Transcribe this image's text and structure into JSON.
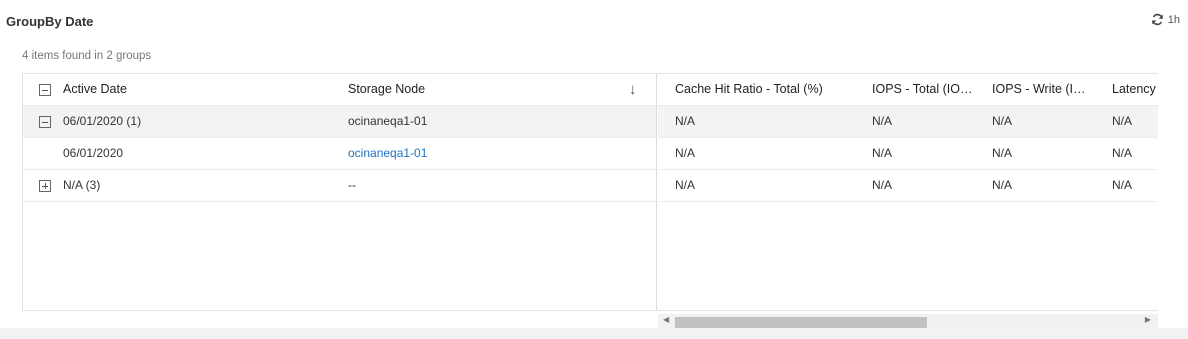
{
  "widget": {
    "title": "GroupBy Date",
    "refresh_label": "1h",
    "count_text": "4 items found in 2 groups"
  },
  "columns": {
    "active_date": "Active Date",
    "storage_node": "Storage Node",
    "cache_hit": "Cache Hit Ratio - Total (%)",
    "iops_total": "IOPS - Total (IO…",
    "iops_write": "IOPS - Write (I…",
    "latency": "Latency"
  },
  "rows": [
    {
      "active_date": "06/01/2020 (1)",
      "storage_node": "ocinaneqa1-01",
      "cache_hit": "N/A",
      "iops_total": "N/A",
      "iops_write": "N/A",
      "latency": "N/A"
    },
    {
      "active_date": "06/01/2020",
      "storage_node": "ocinaneqa1-01",
      "cache_hit": "N/A",
      "iops_total": "N/A",
      "iops_write": "N/A",
      "latency": "N/A"
    },
    {
      "active_date": "N/A (3)",
      "storage_node": "--",
      "cache_hit": "N/A",
      "iops_total": "N/A",
      "iops_write": "N/A",
      "latency": "N/A"
    }
  ],
  "icons": {
    "refresh": "refresh-icon",
    "collapse": "minus-box-icon",
    "expand": "plus-box-icon",
    "sort": "arrow-down-icon"
  },
  "colors": {
    "link": "#1a73c6",
    "selected_row": "#f2f3f5"
  }
}
